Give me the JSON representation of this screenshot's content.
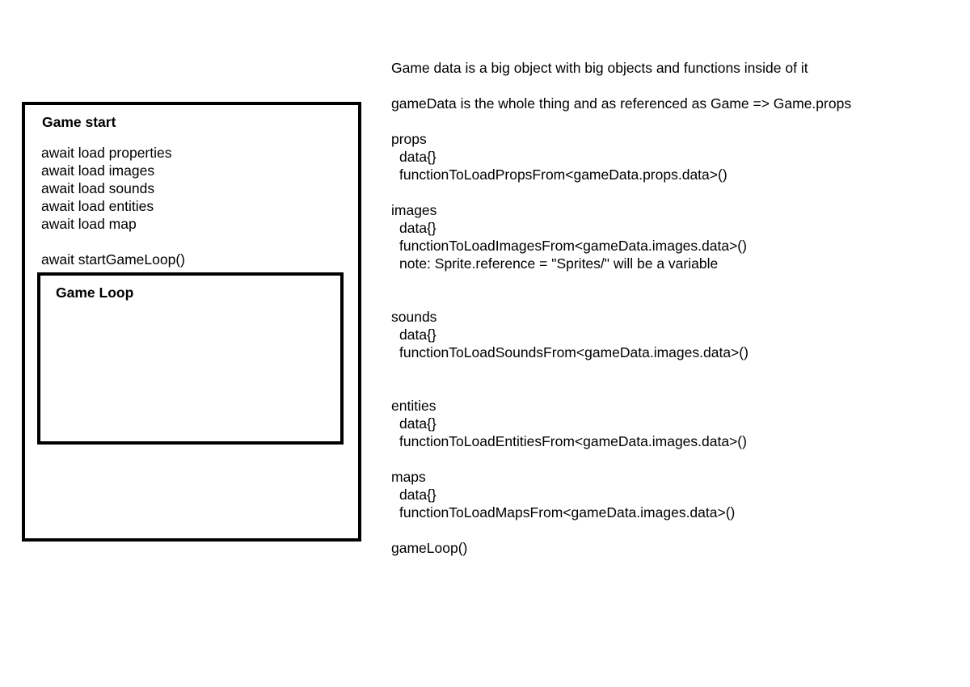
{
  "diagram": {
    "outer_box": {
      "title": "Game start",
      "steps": [
        "await load properties",
        "await load images",
        "await load sounds",
        "await load entities",
        "await load map"
      ],
      "start_loop": "await startGameLoop()"
    },
    "inner_box": {
      "title": "Game Loop"
    }
  },
  "notes": {
    "intro": "Game data is a big object with big objects and functions inside of it",
    "reference": "gameData is the whole thing and as referenced as Game => Game.props",
    "props": {
      "heading": "props",
      "data": "data{}",
      "function": "functionToLoadPropsFrom<gameData.props.data>()"
    },
    "images": {
      "heading": "images",
      "data": "data{}",
      "function": "functionToLoadImagesFrom<gameData.images.data>()",
      "note": "note: Sprite.reference = \"Sprites/\" will be a variable"
    },
    "sounds": {
      "heading": "sounds",
      "data": "data{}",
      "function": "functionToLoadSoundsFrom<gameData.images.data>()"
    },
    "entities": {
      "heading": "entities",
      "data": "data{}",
      "function": "functionToLoadEntitiesFrom<gameData.images.data>()"
    },
    "maps": {
      "heading": "maps",
      "data": "data{}",
      "function": "functionToLoadMapsFrom<gameData.images.data>()"
    },
    "game_loop": "gameLoop()"
  }
}
